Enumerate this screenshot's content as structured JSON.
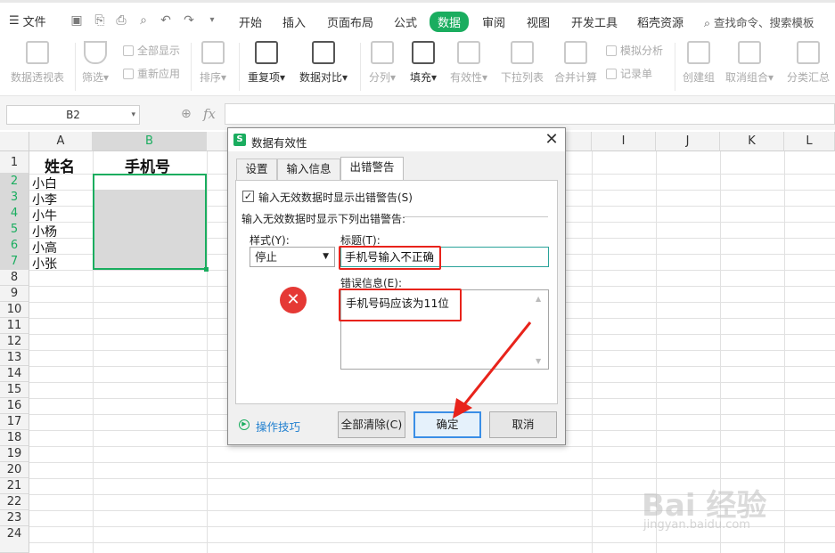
{
  "menubar": {
    "file_label": "文件",
    "tabs": [
      {
        "label": "开始"
      },
      {
        "label": "插入"
      },
      {
        "label": "页面布局"
      },
      {
        "label": "公式"
      },
      {
        "label": "数据",
        "active": true
      },
      {
        "label": "审阅"
      },
      {
        "label": "视图"
      },
      {
        "label": "开发工具"
      },
      {
        "label": "稻壳资源"
      }
    ],
    "search_placeholder": "查找命令、搜索模板"
  },
  "ribbon": {
    "pivot": "数据透视表",
    "filter": "筛选",
    "show_all": "全部显示",
    "reapply": "重新应用",
    "sort": "排序",
    "duplicates": "重复项",
    "compare": "数据对比",
    "split": "分列",
    "fill": "填充",
    "validity": "有效性",
    "dropdown": "下拉列表",
    "consolidate": "合并计算",
    "simulate": "模拟分析",
    "record": "记录单",
    "group": "创建组",
    "ungroup": "取消组合",
    "subtotal": "分类汇总"
  },
  "formula_bar": {
    "name_box": "B2",
    "fx": "fx"
  },
  "sheet": {
    "columns": [
      "A",
      "B",
      "I",
      "J",
      "K",
      "L"
    ],
    "rows": [
      "1",
      "2",
      "3",
      "4",
      "5",
      "6",
      "7",
      "8",
      "9",
      "10",
      "11",
      "12",
      "13",
      "14",
      "15",
      "16",
      "17",
      "18",
      "19",
      "20",
      "21",
      "22",
      "23"
    ],
    "header_a": "姓名",
    "header_b": "手机号",
    "names": [
      "小白",
      "小李",
      "小牛",
      "小杨",
      "小高",
      "小张"
    ]
  },
  "dialog": {
    "title": "数据有效性",
    "tabs": [
      "设置",
      "输入信息",
      "出错警告"
    ],
    "active_tab": "出错警告",
    "checkbox_label": "输入无效数据时显示出错警告(S)",
    "checkbox_checked": true,
    "group_label": "输入无效数据时显示下列出错警告:",
    "style_label": "样式(Y):",
    "style_value": "停止",
    "title_label": "标题(T):",
    "title_value": "手机号输入不正确",
    "message_label": "错误信息(E):",
    "message_value": "手机号码应该为11位",
    "tips_label": "操作技巧",
    "clear_all": "全部清除(C)",
    "ok": "确定",
    "cancel": "取消"
  },
  "watermark": {
    "logo": "Bai 经验",
    "url": "jingyan.baidu.com"
  },
  "colors": {
    "accent": "#1aad5f",
    "highlight": "#e8231b",
    "error_icon": "#e53935",
    "link": "#1f7fcf"
  }
}
